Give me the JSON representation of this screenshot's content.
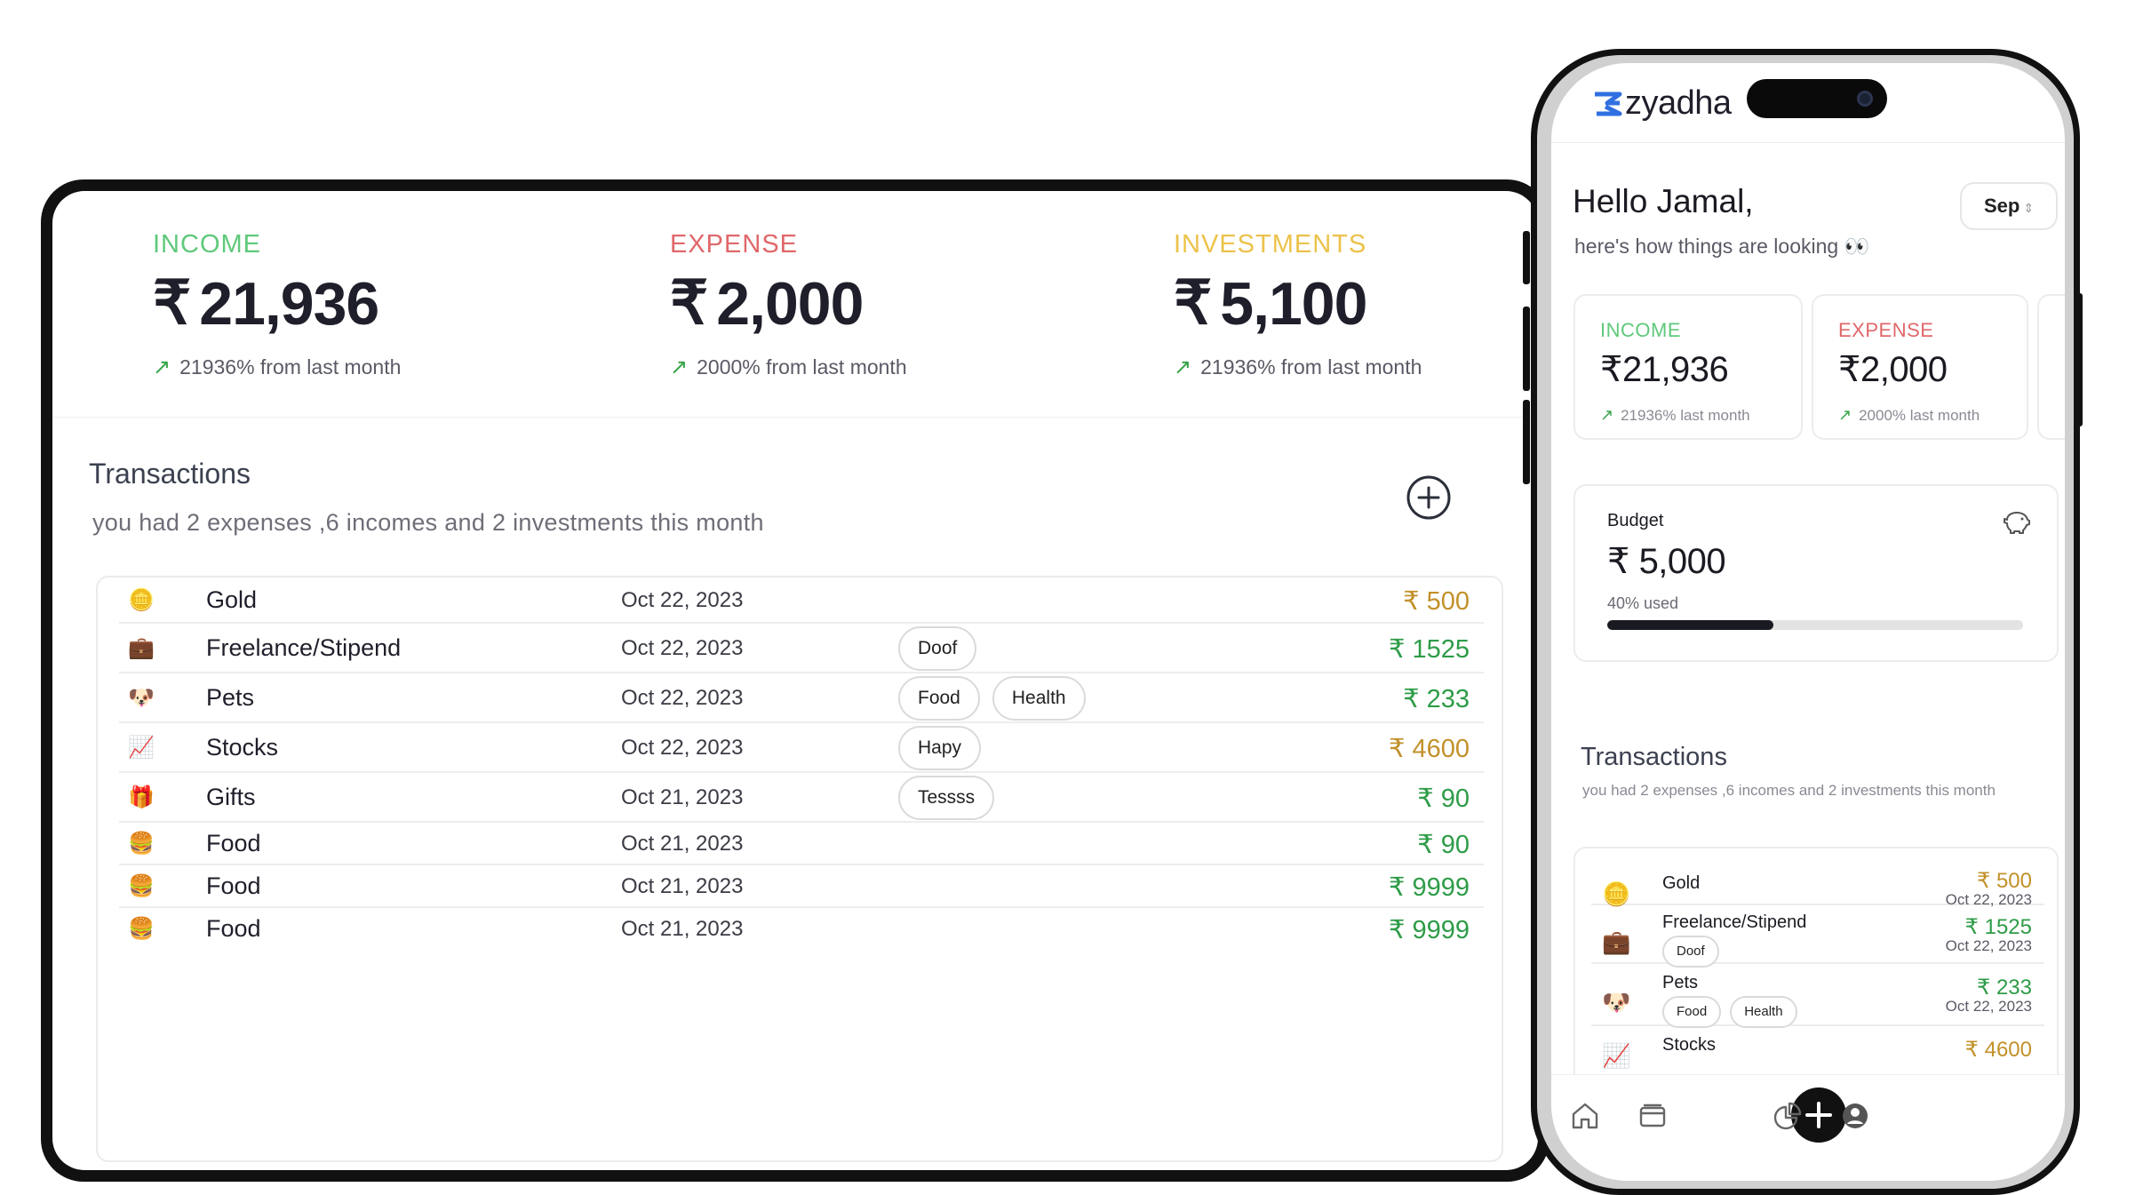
{
  "currency": "₹",
  "colors": {
    "income": "#5fc97b",
    "expense": "#e0676a",
    "investments": "#ecc24a",
    "amount_gold": "#c2912a",
    "amount_green": "#2e9c48",
    "brand_blue": "#2f6fe0"
  },
  "tablet": {
    "stats": [
      {
        "label": "INCOME",
        "value": "21,936",
        "change": "21936% from last month"
      },
      {
        "label": "EXPENSE",
        "value": "2,000",
        "change": "2000% from last month"
      },
      {
        "label": "INVESTMENTS",
        "value": "5,100",
        "change": "21936% from last month"
      }
    ],
    "transactions_title": "Transactions",
    "transactions_subtitle": "you had 2 expenses ,6 incomes and 2 investments this month",
    "rows": [
      {
        "icon": "coin-icon",
        "glyph": "🪙",
        "name": "Gold",
        "date": "Oct 22, 2023",
        "tags": [],
        "amount": "₹ 500",
        "tone": "gold"
      },
      {
        "icon": "briefcase-icon",
        "glyph": "💼",
        "name": "Freelance/Stipend",
        "date": "Oct 22, 2023",
        "tags": [
          "Doof"
        ],
        "amount": "₹ 1525",
        "tone": "green"
      },
      {
        "icon": "dog-icon",
        "glyph": "🐶",
        "name": "Pets",
        "date": "Oct 22, 2023",
        "tags": [
          "Food",
          "Health"
        ],
        "amount": "₹ 233",
        "tone": "green"
      },
      {
        "icon": "chart-up-icon",
        "glyph": "📈",
        "name": "Stocks",
        "date": "Oct 22, 2023",
        "tags": [
          "Hapy"
        ],
        "amount": "₹ 4600",
        "tone": "gold"
      },
      {
        "icon": "gift-icon",
        "glyph": "🎁",
        "name": "Gifts",
        "date": "Oct 21, 2023",
        "tags": [
          "Tessss"
        ],
        "amount": "₹ 90",
        "tone": "green"
      },
      {
        "icon": "burger-icon",
        "glyph": "🍔",
        "name": "Food",
        "date": "Oct 21, 2023",
        "tags": [],
        "amount": "₹ 90",
        "tone": "green"
      },
      {
        "icon": "burger-icon",
        "glyph": "🍔",
        "name": "Food",
        "date": "Oct 21, 2023",
        "tags": [],
        "amount": "₹ 9999",
        "tone": "green"
      },
      {
        "icon": "burger-icon",
        "glyph": "🍔",
        "name": "Food",
        "date": "Oct 21, 2023",
        "tags": [],
        "amount": "₹ 9999",
        "tone": "green"
      }
    ]
  },
  "phone": {
    "brand": "zyadha",
    "greeting": "Hello Jamal,",
    "greeting_sub": "here's how things are looking 👀",
    "month": "Sep",
    "stats": [
      {
        "label": "INCOME",
        "value": "21,936",
        "change": "21936% last month"
      },
      {
        "label": "EXPENSE",
        "value": "2,000",
        "change": "2000% last month"
      }
    ],
    "budget": {
      "label": "Budget",
      "value": "₹ 5,000",
      "used_text": "40% used",
      "used_fraction": 0.4
    },
    "transactions_title": "Transactions",
    "transactions_subtitle": "you had 2 expenses ,6 incomes and 2 investments this month",
    "rows": [
      {
        "icon": "coin-icon",
        "glyph": "🪙",
        "name": "Gold",
        "date": "Oct 22, 2023",
        "tags": [],
        "amount": "₹ 500",
        "tone": "gold"
      },
      {
        "icon": "briefcase-icon",
        "glyph": "💼",
        "name": "Freelance/Stipend",
        "date": "Oct 22, 2023",
        "tags": [
          "Doof"
        ],
        "amount": "₹ 1525",
        "tone": "green"
      },
      {
        "icon": "dog-icon",
        "glyph": "🐶",
        "name": "Pets",
        "date": "Oct 22, 2023",
        "tags": [
          "Food",
          "Health"
        ],
        "amount": "₹ 233",
        "tone": "green"
      },
      {
        "icon": "chart-up-icon",
        "glyph": "📈",
        "name": "Stocks",
        "date": "",
        "tags": [],
        "amount": "₹ 4600",
        "tone": "gold"
      }
    ],
    "nav": [
      "home-icon",
      "wallet-icon",
      "add-icon",
      "pie-chart-icon",
      "profile-icon"
    ]
  }
}
